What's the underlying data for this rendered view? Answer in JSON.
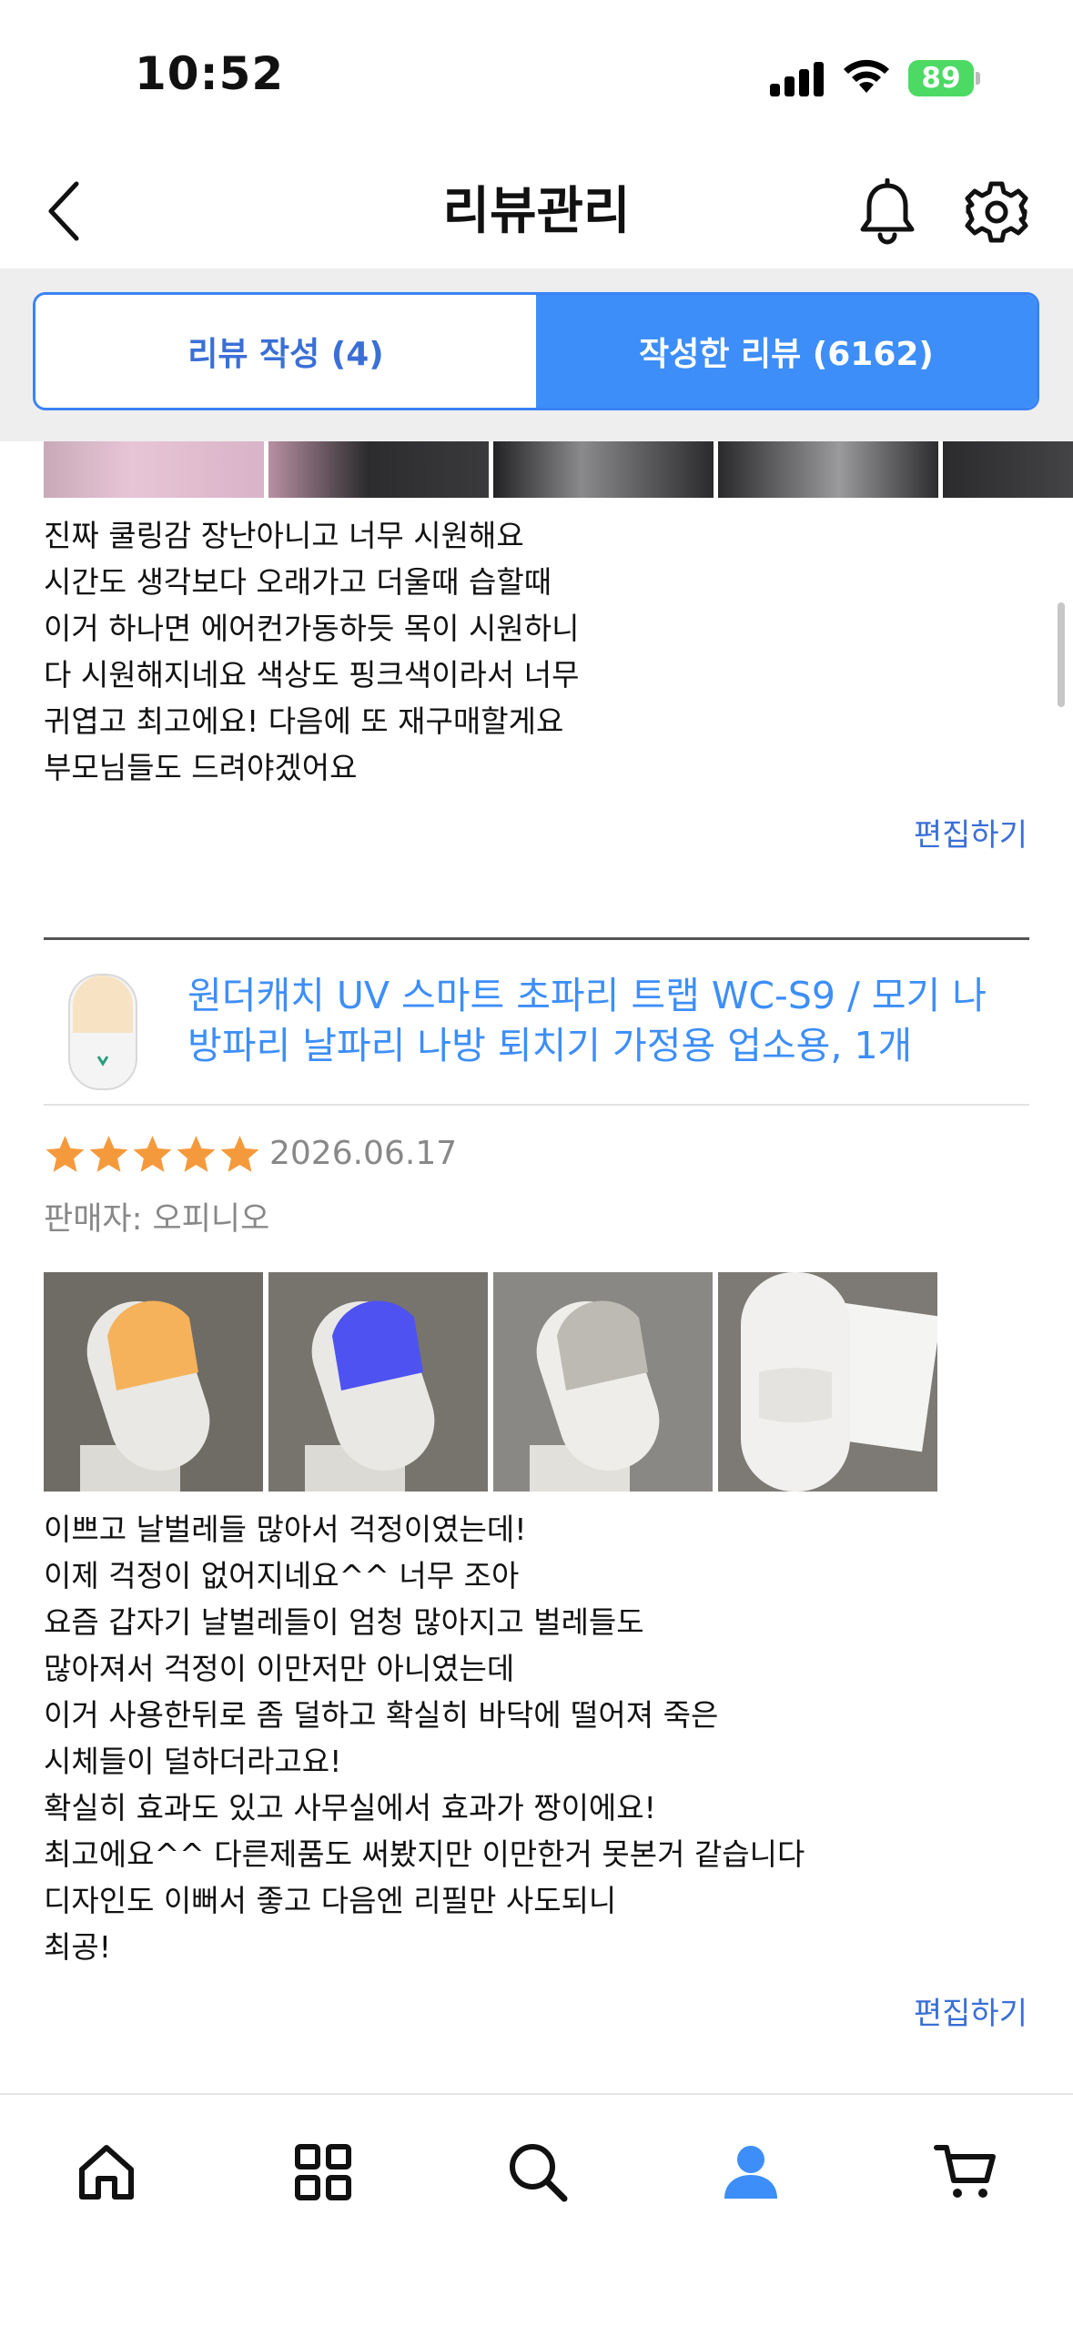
{
  "status_bar": {
    "time": "10:52",
    "battery": "89"
  },
  "header": {
    "title": "리뷰관리"
  },
  "tabs": [
    {
      "label": "리뷰 작성 (4)",
      "active": false
    },
    {
      "label": "작성한 리뷰 (6162)",
      "active": true
    }
  ],
  "reviews": [
    {
      "text": "진짜 쿨링감 장난아니고 너무 시원해요\n시간도 생각보다 오래가고 더울때 습할때\n이거 하나면 에어컨가동하듯 목이 시원하니\n다 시원해지네요 색상도 핑크색이라서 너무\n귀엽고 최고에요! 다음에 또 재구매할게요\n부모님들도 드려야겠어요",
      "edit_label": "편집하기"
    },
    {
      "product_name": "원더캐치 UV 스마트 초파리 트랩 WC-S9 / 모기 나방파리 날파리 나방 퇴치기 가정용 업소용, 1개",
      "rating": 5,
      "date": "2026.06.17",
      "seller": "판매자: 오피니오",
      "text": "이쁘고 날벌레들 많아서 걱정이였는데!\n이제 걱정이 없어지네요^^ 너무 조아\n요즘 갑자기 날벌레들이 엄청 많아지고 벌레들도\n많아져서 걱정이 이만저만 아니였는데\n이거 사용한뒤로 좀 덜하고 확실히 바닥에 떨어져 죽은\n시체들이 덜하더라고요!\n확실히 효과도 있고 사무실에서 효과가 짱이에요!\n최고에요^^ 다른제품도 써봤지만 이만한거 못본거 같습니다\n디자인도 이뻐서 좋고 다음엔 리필만 사도되니\n최공!",
      "edit_label": "편집하기"
    }
  ],
  "colors": {
    "accent": "#3d8ef8",
    "link": "#3b6fd6",
    "star": "#f59a3c"
  },
  "bottom_nav": [
    {
      "icon": "home-icon"
    },
    {
      "icon": "category-grid-icon"
    },
    {
      "icon": "search-icon"
    },
    {
      "icon": "my-page-icon",
      "active": true
    },
    {
      "icon": "cart-icon"
    }
  ]
}
